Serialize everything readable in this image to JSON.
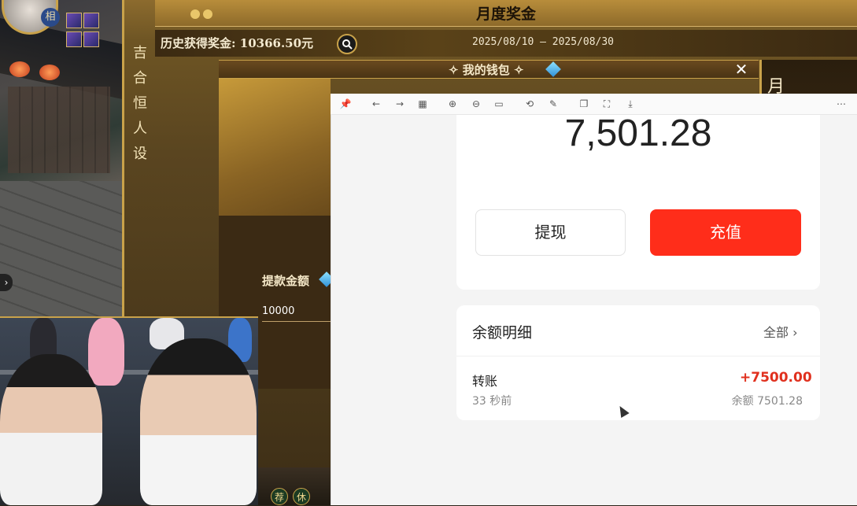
{
  "game": {
    "avatar_badge": "相",
    "panel_title": "月度奖金",
    "side_text": [
      "吉",
      "合",
      "恒",
      "人",
      "设"
    ],
    "history_label": "历史获得奖金: 10366.50元",
    "date_range": "2025/08/10  –  2025/08/30",
    "right_card_char": "月",
    "bottom_tags": [
      "荐",
      "休"
    ]
  },
  "wallet": {
    "title": "我的钱包",
    "close_icon": "close-icon",
    "withdraw_label": "提款金额",
    "withdraw_value": "10000"
  },
  "viewer": {
    "toolbar_icons": [
      "pin-icon",
      "back-arrow-icon",
      "forward-arrow-icon",
      "grid-icon",
      "zoom-in-icon",
      "zoom-out-icon",
      "fit-width-icon",
      "rotate-icon",
      "edit-icon",
      "copy-icon",
      "crop-icon",
      "download-icon",
      "more-icon"
    ],
    "balance": "7,501.28",
    "withdraw_button": "提现",
    "recharge_button": "充值",
    "detail_title": "余额明细",
    "detail_all": "全部",
    "transactions": [
      {
        "type": "转账",
        "time": "33 秒前",
        "amount": "+7500.00",
        "balance": "余额 7501.28"
      }
    ],
    "colors": {
      "recharge": "#ff2d1a",
      "amount": "#e0301e"
    }
  }
}
